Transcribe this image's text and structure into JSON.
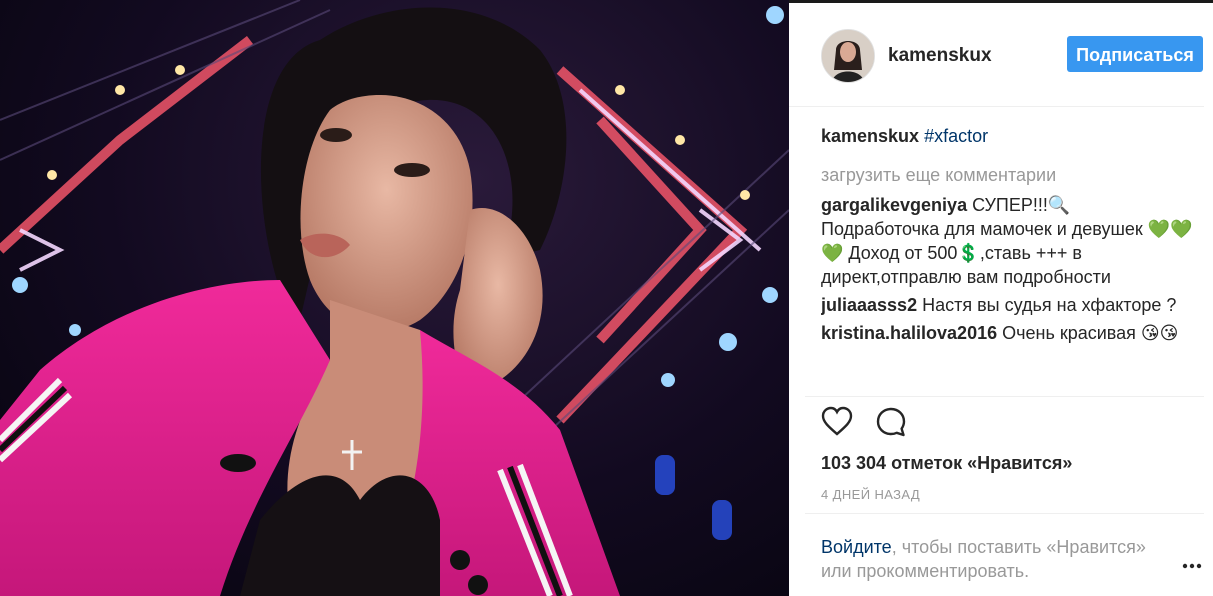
{
  "post": {
    "username": "kamenskux",
    "follow_label": "Подписаться",
    "caption": {
      "user": "kamenskux",
      "hashtag": "#xfactor"
    },
    "load_more": "загрузить еще комментарии",
    "comments": [
      {
        "user": "gargalikevgeniya",
        "text": "СУПЕР!!!🔍 Подработочка для мамочек и девушек 💚💚💚 Доход от 500💲,ставь +++ в директ,отправлю вам подробности"
      },
      {
        "user": "juliaaasss2",
        "text": "Настя вы судья на хфакторе ?"
      },
      {
        "user": "kristina.halilova2016",
        "text": "Очень красивая 😘😘"
      }
    ],
    "likes_text": "103 304 отметок «Нравится»",
    "time_text": "4 ДНЕЙ НАЗАД",
    "login": {
      "link": "Войдите",
      "rest": ", чтобы поставить «Нравится» или прокомментировать."
    },
    "icons": {
      "like": "heart-icon",
      "comment": "speech-bubble-icon",
      "more": "more-dots-icon"
    },
    "colors": {
      "follow_button": "#3897f0",
      "link": "#003569",
      "muted": "#999999",
      "jacket_pink": "#e0208c"
    }
  }
}
